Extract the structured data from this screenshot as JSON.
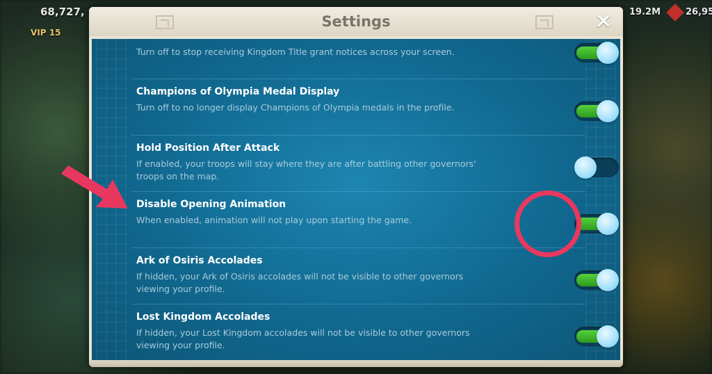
{
  "background_hud": {
    "power": "68,727,",
    "vip": "VIP 15",
    "resource_1": "19.2M",
    "resource_2": "26,95"
  },
  "dialog": {
    "title": "Settings",
    "close_icon": "close-icon"
  },
  "settings": [
    {
      "title": "",
      "description": "Turn off to stop receiving Kingdom Title grant notices across your screen.",
      "enabled": true
    },
    {
      "title": "Champions of Olympia Medal Display",
      "description": "Turn off to no longer display Champions of Olympia medals in the profile.",
      "enabled": true
    },
    {
      "title": "Hold Position After Attack",
      "description": "If enabled, your troops will stay where they are after battling other governors' troops on the map.",
      "enabled": false
    },
    {
      "title": "Disable Opening Animation",
      "description": "When enabled, animation will not play upon starting the game.",
      "enabled": true
    },
    {
      "title": "Ark of Osiris Accolades",
      "description": "If hidden, your Ark of Osiris accolades will not be visible to other governors viewing your profile.",
      "enabled": true
    },
    {
      "title": "Lost Kingdom Accolades",
      "description": "If hidden, your Lost Kingdom accolades will not be visible to other governors viewing your profile.",
      "enabled": true
    }
  ],
  "annotation": {
    "arrow_color": "#e8385f",
    "ring_color": "#e8385f"
  },
  "colors": {
    "panel_blue": "#11688f",
    "toggle_green": "#54d13a",
    "title_text": "#7a7468"
  }
}
